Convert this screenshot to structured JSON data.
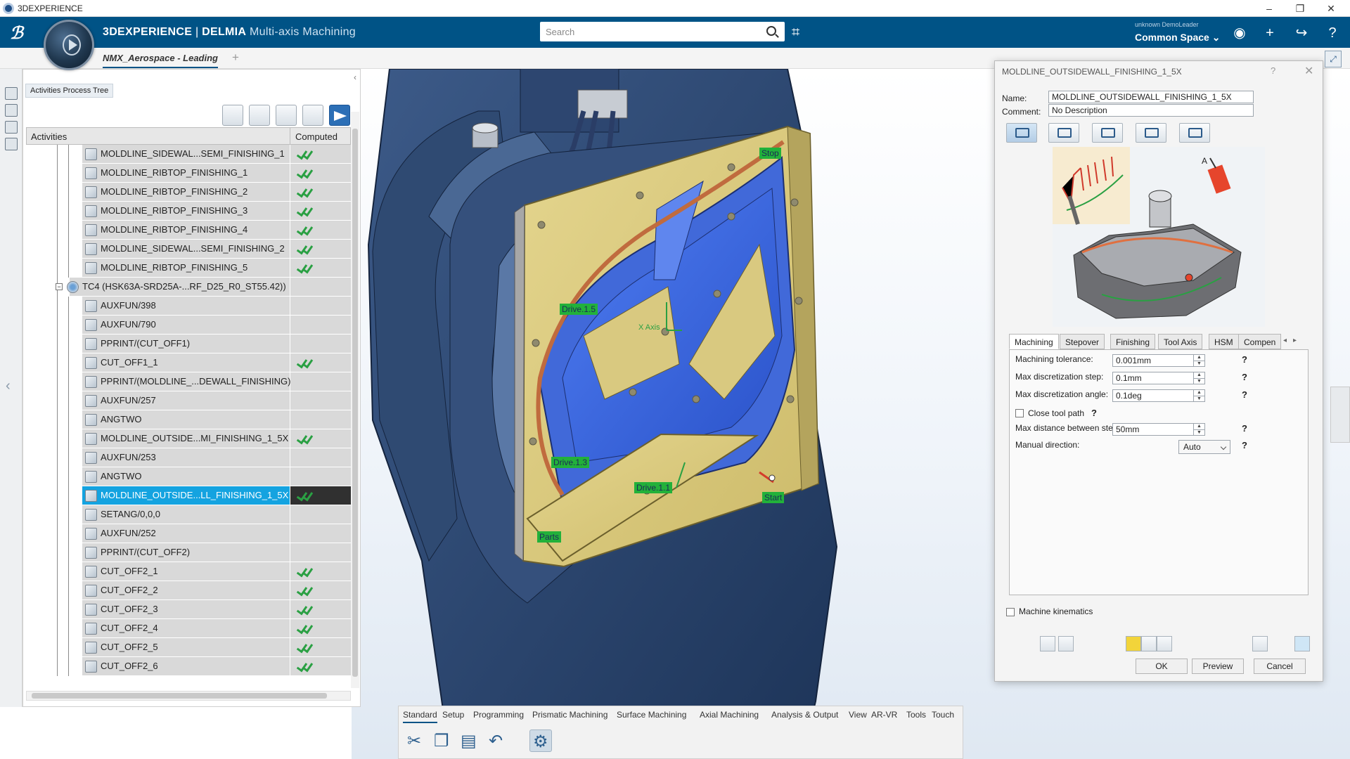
{
  "window": {
    "title": "3DEXPERIENCE",
    "controls": [
      "–",
      "❐",
      "✕"
    ]
  },
  "header": {
    "brand": "3DEXPERIENCE",
    "brand_sep": " | ",
    "product": "DELMIA",
    "app": "Multi-axis Machining",
    "search_placeholder": "Search",
    "user": "unknown DemoLeader",
    "space": "Common Space ⌄",
    "colors": {
      "header_bg": "#005386",
      "accent": "#14a3e0"
    }
  },
  "doc_tab": {
    "label": "NMX_Aerospace - Leading",
    "add": "+"
  },
  "tree": {
    "title": "Activities Process Tree",
    "col_activities": "Activities",
    "col_computed": "Computed",
    "rows": [
      {
        "label": "MOLDLINE_SIDEWAL...SEMI_FINISHING_1",
        "computed": true,
        "indent": 2,
        "selected": false
      },
      {
        "label": "MOLDLINE_RIBTOP_FINISHING_1",
        "computed": true,
        "indent": 2,
        "selected": false
      },
      {
        "label": "MOLDLINE_RIBTOP_FINISHING_2",
        "computed": true,
        "indent": 2,
        "selected": false
      },
      {
        "label": "MOLDLINE_RIBTOP_FINISHING_3",
        "computed": true,
        "indent": 2,
        "selected": false
      },
      {
        "label": "MOLDLINE_RIBTOP_FINISHING_4",
        "computed": true,
        "indent": 2,
        "selected": false
      },
      {
        "label": "MOLDLINE_SIDEWAL...SEMI_FINISHING_2",
        "computed": true,
        "indent": 2,
        "selected": false
      },
      {
        "label": "MOLDLINE_RIBTOP_FINISHING_5",
        "computed": true,
        "indent": 2,
        "selected": false
      },
      {
        "label": "TC4 (HSK63A-SRD25A-...RF_D25_R0_ST55.42))",
        "computed": false,
        "indent": 1,
        "selected": false,
        "tool": true
      },
      {
        "label": "AUXFUN/398",
        "computed": false,
        "indent": 2,
        "selected": false
      },
      {
        "label": "AUXFUN/790",
        "computed": false,
        "indent": 2,
        "selected": false
      },
      {
        "label": "PPRINT/(CUT_OFF1)",
        "computed": false,
        "indent": 2,
        "selected": false
      },
      {
        "label": "CUT_OFF1_1",
        "computed": true,
        "indent": 2,
        "selected": false
      },
      {
        "label": "PPRINT/(MOLDLINE_...DEWALL_FINISHING)",
        "computed": false,
        "indent": 2,
        "selected": false
      },
      {
        "label": "AUXFUN/257",
        "computed": false,
        "indent": 2,
        "selected": false
      },
      {
        "label": "ANGTWO",
        "computed": false,
        "indent": 2,
        "selected": false
      },
      {
        "label": "MOLDLINE_OUTSIDE...MI_FINISHING_1_5X",
        "computed": true,
        "indent": 2,
        "selected": false
      },
      {
        "label": "AUXFUN/253",
        "computed": false,
        "indent": 2,
        "selected": false
      },
      {
        "label": "ANGTWO",
        "computed": false,
        "indent": 2,
        "selected": false
      },
      {
        "label": "MOLDLINE_OUTSIDE...LL_FINISHING_1_5X",
        "computed": true,
        "indent": 2,
        "selected": true
      },
      {
        "label": "SETANG/0,0,0",
        "computed": false,
        "indent": 2,
        "selected": false
      },
      {
        "label": "AUXFUN/252",
        "computed": false,
        "indent": 2,
        "selected": false
      },
      {
        "label": "PPRINT/(CUT_OFF2)",
        "computed": false,
        "indent": 2,
        "selected": false
      },
      {
        "label": "CUT_OFF2_1",
        "computed": true,
        "indent": 2,
        "selected": false
      },
      {
        "label": "CUT_OFF2_2",
        "computed": true,
        "indent": 2,
        "selected": false
      },
      {
        "label": "CUT_OFF2_3",
        "computed": true,
        "indent": 2,
        "selected": false
      },
      {
        "label": "CUT_OFF2_4",
        "computed": true,
        "indent": 2,
        "selected": false
      },
      {
        "label": "CUT_OFF2_5",
        "computed": true,
        "indent": 2,
        "selected": false
      },
      {
        "label": "CUT_OFF2_6",
        "computed": true,
        "indent": 2,
        "selected": false
      }
    ]
  },
  "viewport": {
    "labels": {
      "stop": "Stop",
      "drive15": "Drive.1.5",
      "drive13": "Drive.1.3",
      "drive11": "Drive.1.1",
      "start": "Start",
      "parts": "Parts",
      "axis": "X Axis"
    }
  },
  "action_bar": {
    "tabs": [
      "Standard",
      "Setup",
      "Programming",
      "Prismatic Machining",
      "Surface Machining",
      "Axial Machining",
      "Analysis & Output",
      "View",
      "AR-VR",
      "Tools",
      "Touch"
    ],
    "active_tab": "Standard",
    "tools": [
      "scissors-icon",
      "copy-icon",
      "paste-icon",
      "undo-icon",
      "update-icon"
    ]
  },
  "dialog": {
    "title": "MOLDLINE_OUTSIDEWALL_FINISHING_1_5X",
    "help": "?",
    "close": "✕",
    "name_label": "Name:",
    "name_value": "MOLDLINE_OUTSIDEWALL_FINISHING_1_5X",
    "comment_label": "Comment:",
    "comment_value": "No Description",
    "preview_label": "A",
    "subtabs": [
      "Machining",
      "Stepover",
      "Finishing",
      "Tool Axis",
      "HSM",
      "Compen"
    ],
    "active_subtab": "Machining",
    "params": {
      "machining_tolerance_label": "Machining tolerance:",
      "machining_tolerance": "0.001mm",
      "max_disc_step_label": "Max discretization step:",
      "max_disc_step": "0.1mm",
      "max_disc_angle_label": "Max discretization angle:",
      "max_disc_angle": "0.1deg",
      "close_tool_path_label": "Close tool path",
      "max_dist_label": "Max distance between steps:",
      "max_dist": "50mm",
      "manual_direction_label": "Manual direction:",
      "manual_direction": "Auto"
    },
    "machine_kinematics_label": "Machine kinematics",
    "ok": "OK",
    "preview": "Preview",
    "cancel": "Cancel"
  }
}
